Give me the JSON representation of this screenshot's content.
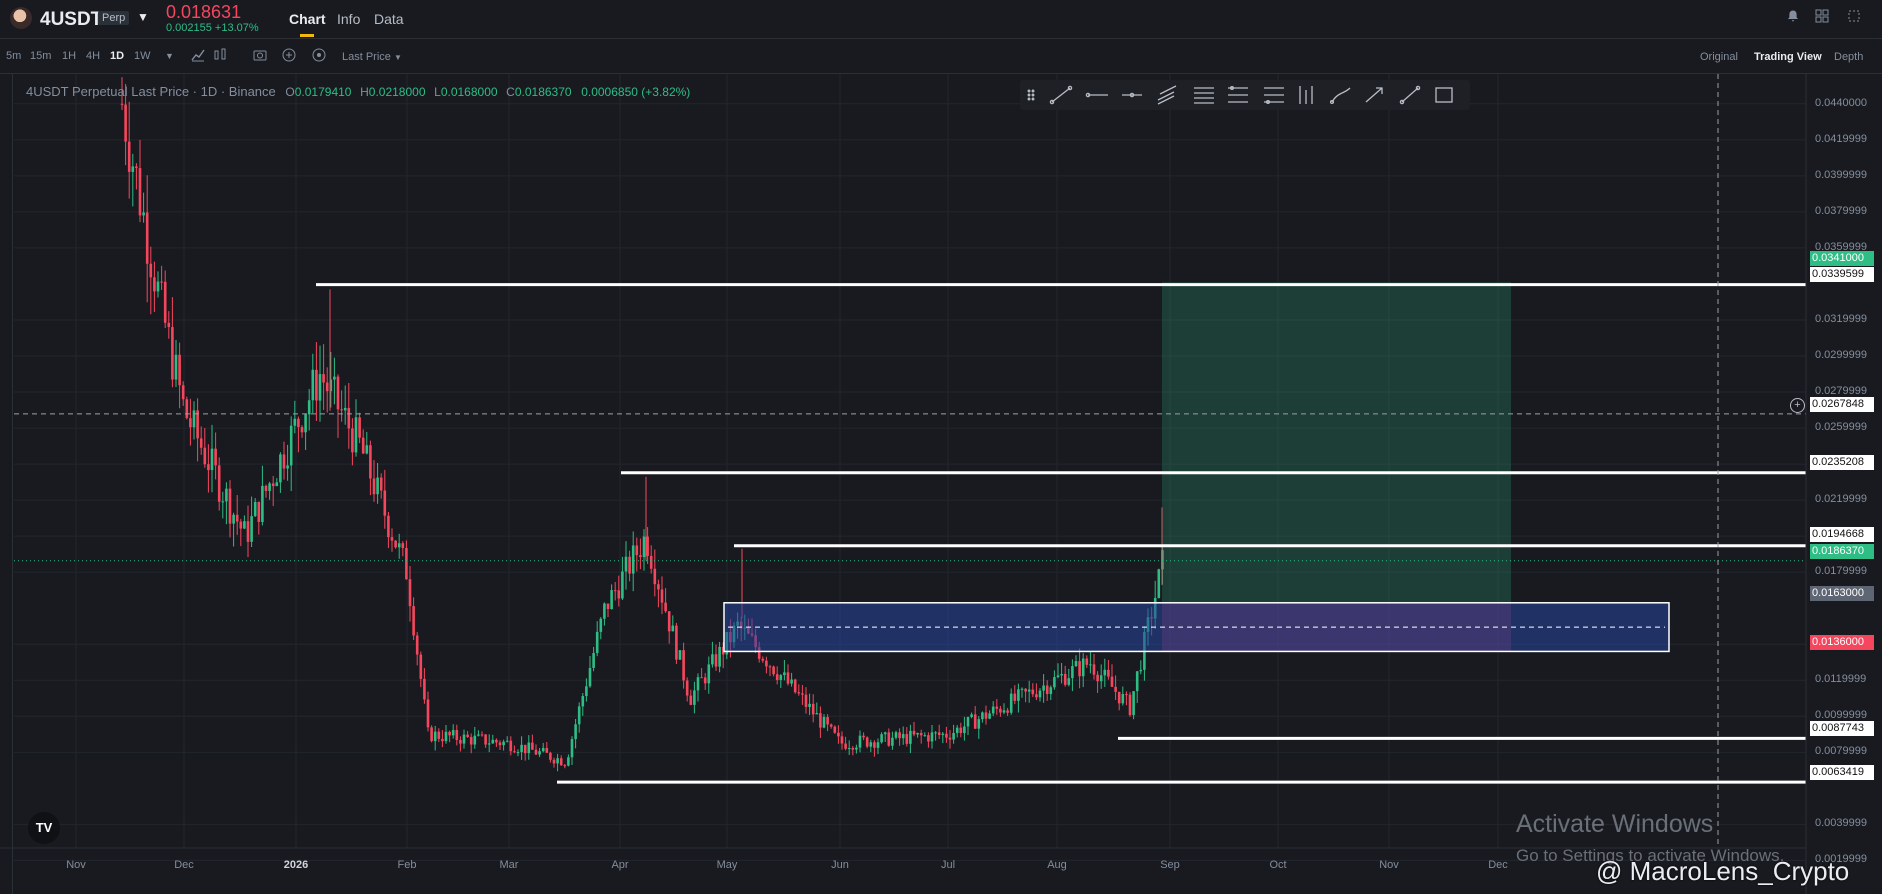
{
  "header": {
    "symbol": "4USDT",
    "badge": "Perp",
    "last_price": "0.018631",
    "change": "0.002155 +13.07%",
    "tabs": [
      "Chart",
      "Info",
      "Data"
    ]
  },
  "toolbar": {
    "timeframes": [
      "5m",
      "15m",
      "1H",
      "4H",
      "1D",
      "1W"
    ],
    "active_timeframe": "1D",
    "price_type": "Last Price",
    "views": [
      "Original",
      "Trading View",
      "Depth"
    ],
    "active_view": "Trading View"
  },
  "legend": {
    "title": "4USDT Perpetual Last Price · 1D · Binance",
    "open_label": "O",
    "open": "0.0179410",
    "high_label": "H",
    "high": "0.0218000",
    "low_label": "L",
    "low": "0.0168000",
    "close_label": "C",
    "close": "0.0186370",
    "change": "0.0006850 (+3.82%)"
  },
  "colors": {
    "up": "#2ebd85",
    "down": "#f6465d",
    "background": "#181a20",
    "accent": "#f0b90b"
  },
  "chart_data": {
    "type": "candlestick",
    "symbol": "4USDT",
    "interval": "1D",
    "ylim": [
      0.0018,
      0.0446
    ],
    "x_tick_labels": [
      "Nov",
      "Dec",
      "2026",
      "Feb",
      "Mar",
      "Apr",
      "May",
      "Jun",
      "Jul",
      "Aug",
      "Sep",
      "Oct",
      "Nov",
      "Dec"
    ],
    "y_tick_labels": [
      "0.0440000",
      "0.0419999",
      "0.0399999",
      "0.0379999",
      "0.0359999",
      "0.0319999",
      "0.0299999",
      "0.0279999",
      "0.0259999",
      "0.0239999",
      "0.0219999",
      "0.0199999",
      "0.0179999",
      "0.0139999",
      "0.0119999",
      "0.0099999",
      "0.0079999",
      "0.0039999",
      "0.0019999"
    ],
    "price_levels": [
      {
        "value": 0.0339599,
        "label": "0.0339599",
        "style": "white"
      },
      {
        "value": 0.0235208,
        "label": "0.0235208",
        "style": "white"
      },
      {
        "value": 0.0194668,
        "label": "0.0194668",
        "style": "white"
      },
      {
        "value": 0.0087743,
        "label": "0.0087743",
        "style": "white"
      },
      {
        "value": 0.0063419,
        "label": "0.0063419",
        "style": "white"
      }
    ],
    "position_labels": {
      "take_profit": "0.0341000",
      "entry": "0.0163000",
      "stop": "0.0136000",
      "current": "0.0186370",
      "crosshair": "0.0267848"
    },
    "close_trend": [
      {
        "t": "late Oct",
        "close": 0.044
      },
      {
        "t": "mid Nov",
        "close": 0.033
      },
      {
        "t": "early Dec",
        "close": 0.027
      },
      {
        "t": "mid Dec",
        "close": 0.02
      },
      {
        "t": "early Jan",
        "close": 0.029
      },
      {
        "t": "mid Jan",
        "close": 0.025
      },
      {
        "t": "early Feb",
        "close": 0.018
      },
      {
        "t": "mid Feb",
        "close": 0.009
      },
      {
        "t": "early Mar",
        "close": 0.0085
      },
      {
        "t": "late Mar",
        "close": 0.0075
      },
      {
        "t": "early Apr",
        "close": 0.016
      },
      {
        "t": "Apr peak",
        "close": 0.02
      },
      {
        "t": "late Apr",
        "close": 0.011
      },
      {
        "t": "early May",
        "close": 0.015
      },
      {
        "t": "Jun",
        "close": 0.0085
      },
      {
        "t": "Jul",
        "close": 0.009
      },
      {
        "t": "mid Aug",
        "close": 0.013
      },
      {
        "t": "late Aug",
        "close": 0.0105
      },
      {
        "t": "end Aug",
        "close": 0.0186
      }
    ]
  },
  "watermark": {
    "line1": "Activate Windows",
    "line2": "Go to Settings to activate Windows.",
    "handle": "@ MacroLens_Crypto"
  }
}
